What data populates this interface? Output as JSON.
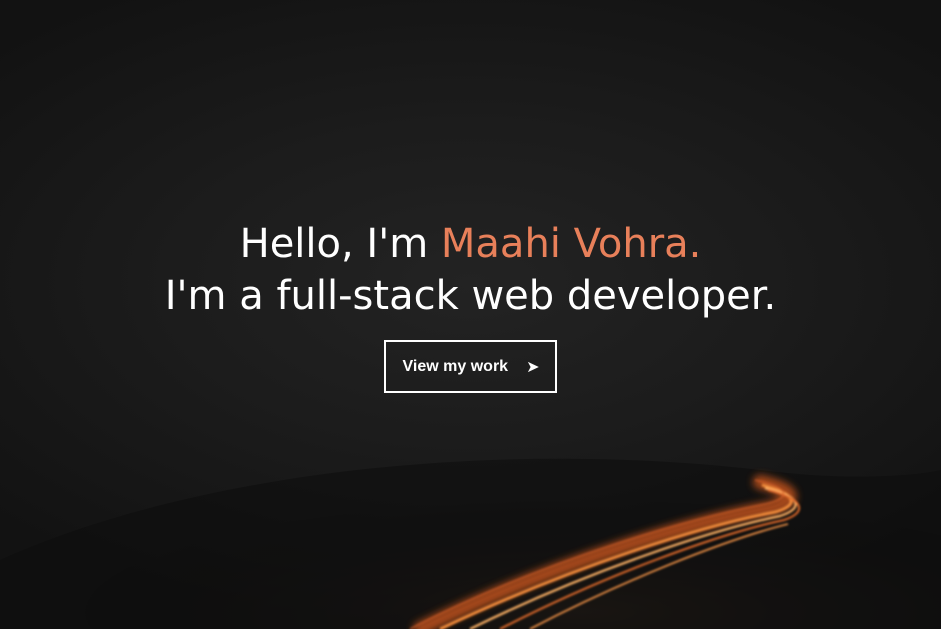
{
  "hero": {
    "greeting": "Hello, I'm ",
    "name": "Maahi Vohra.",
    "tagline": "I'm a full-stack web developer.",
    "cta_label": "View my work",
    "cta_icon": "arrow-right-icon"
  },
  "colors": {
    "accent": "#e8805a",
    "text": "#ffffff",
    "background": "#1a1a1a"
  }
}
